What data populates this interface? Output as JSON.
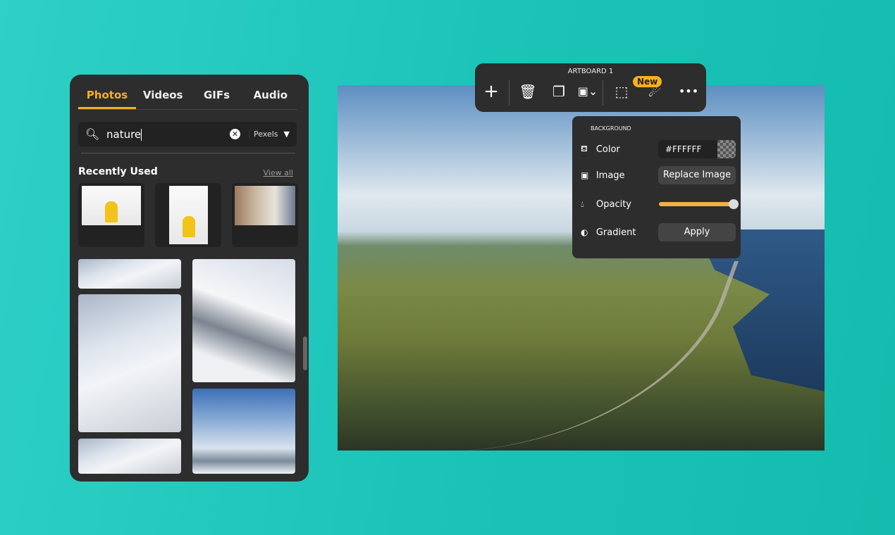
{
  "media_panel": {
    "tabs": [
      {
        "label": "Photos",
        "active": true
      },
      {
        "label": "Videos"
      },
      {
        "label": "GIFs"
      },
      {
        "label": "Audio"
      }
    ],
    "search": {
      "value": "nature",
      "source": "Pexels",
      "icon": "search-icon"
    },
    "recently_used": {
      "title": "Recently Used",
      "view_all": "View all"
    },
    "accent": "#f5b21b"
  },
  "toolbar": {
    "title": "ARTBOARD 1",
    "new_badge": "New",
    "buttons": [
      "add",
      "delete",
      "duplicate",
      "image-menu",
      "resize",
      "magic",
      "more"
    ]
  },
  "background_popup": {
    "title": "BACKGROUND",
    "color": {
      "label": "Color",
      "value": "#FFFFFF"
    },
    "image": {
      "label": "Image",
      "button": "Replace Image"
    },
    "opacity": {
      "label": "Opacity",
      "value": 100
    },
    "gradient": {
      "label": "Gradient",
      "button": "Apply"
    }
  }
}
